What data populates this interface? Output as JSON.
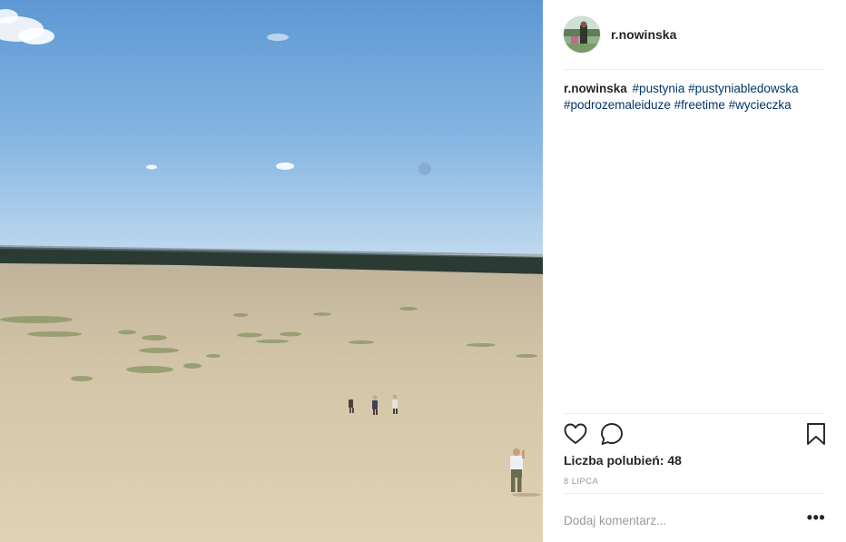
{
  "post": {
    "username": "r.nowinska",
    "avatar_icon": "user-avatar",
    "caption": {
      "user": "r.nowinska",
      "hashtags": [
        "#pustynia",
        "#pustyniabledowska",
        "#podrozemaleiduze",
        "#freetime",
        "#wycieczka"
      ]
    },
    "likes_text": "Liczba polubień: 48",
    "date": "8 LIPCA",
    "comment_placeholder": "Dodaj komentarz...",
    "more_label": "•••"
  },
  "icons": {
    "like": "heart-icon",
    "comment": "comment-icon",
    "save": "bookmark-icon"
  },
  "colors": {
    "hashtag": "#003569",
    "text": "#262626",
    "muted": "#999999",
    "divider": "#efefef"
  }
}
